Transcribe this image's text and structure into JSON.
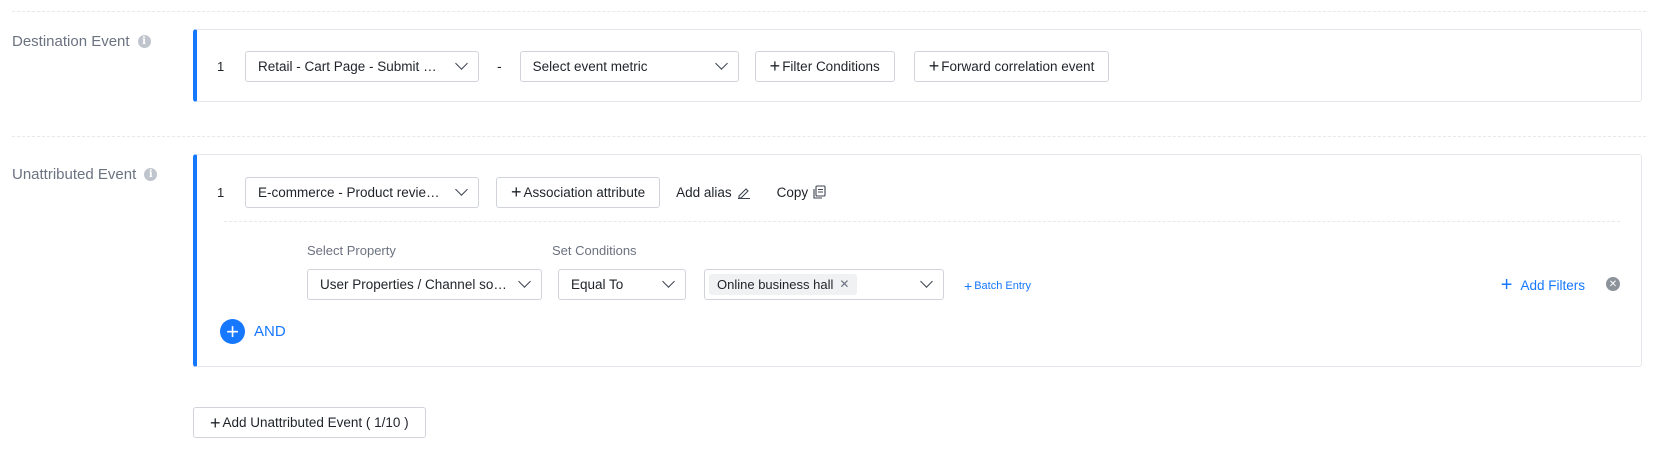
{
  "destination": {
    "label": "Destination Event",
    "index": "1",
    "event_select": "Retail - Cart Page - Submit Orde...",
    "separator": "-",
    "metric_placeholder": "Select event metric",
    "filter_button": "Filter Conditions",
    "forward_button": "Forward correlation event"
  },
  "unattributed": {
    "label": "Unattributed Event",
    "index": "1",
    "event_select": "E-commerce - Product review p...",
    "association_button": "Association attribute",
    "add_alias": "Add alias",
    "copy": "Copy",
    "select_property_label": "Select Property",
    "set_conditions_label": "Set Conditions",
    "property_select": "User Properties / Channel source",
    "condition_select": "Equal To",
    "value_tag": "Online business hall",
    "batch_entry": "Batch Entry",
    "add_filters": "Add Filters",
    "and_label": "AND"
  },
  "footer": {
    "add_unattributed": "Add Unattributed Event ( 1/10 )"
  },
  "colors": {
    "accent": "#1677ff",
    "border": "#d0d4da",
    "muted_text": "#6b7280"
  }
}
